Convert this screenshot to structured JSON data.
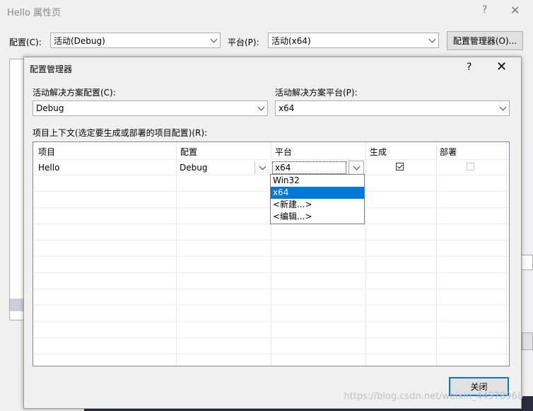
{
  "background_window": {
    "title": "Hello 属性页",
    "help_glyph": "?",
    "close_glyph": "✕",
    "config_label": "配置(C):",
    "config_value": "活动(Debug)",
    "platform_label": "平台(P):",
    "platform_value": "活动(x64)",
    "config_manager_button": "配置管理器(O)..."
  },
  "dialog": {
    "title": "配置管理器",
    "help_glyph": "?",
    "close_glyph": "✕",
    "solution_config_label": "活动解决方案配置(C):",
    "solution_config_value": "Debug",
    "solution_platform_label": "活动解决方案平台(P):",
    "solution_platform_value": "x64",
    "project_contexts_label": "项目上下文(选定要生成或部署的项目配置)(R):",
    "grid": {
      "headers": [
        "项目",
        "配置",
        "平台",
        "生成",
        "部署"
      ],
      "rows": [
        {
          "project": "Hello",
          "config": "Debug",
          "platform": "x64",
          "build_checked": true,
          "deploy_checked": false,
          "deploy_enabled": false
        }
      ]
    },
    "platform_dropdown": {
      "options": [
        "Win32",
        "x64",
        "<新建...>",
        "<编辑...>"
      ],
      "selected_index": 1
    },
    "close_button": "关闭"
  },
  "watermark": "https://blog.csdn.net/weixin_44578968"
}
